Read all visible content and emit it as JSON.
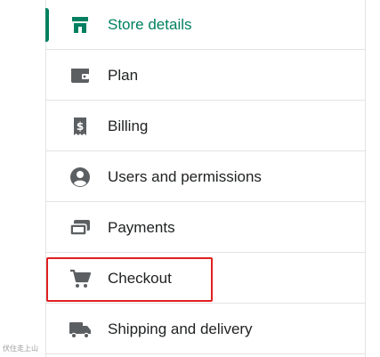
{
  "settings_nav": {
    "items": [
      {
        "label": "Store details",
        "icon": "store-icon",
        "active": true
      },
      {
        "label": "Plan",
        "icon": "wallet-icon",
        "active": false
      },
      {
        "label": "Billing",
        "icon": "dollar-receipt-icon",
        "active": false
      },
      {
        "label": "Users and permissions",
        "icon": "user-circle-icon",
        "active": false
      },
      {
        "label": "Payments",
        "icon": "cards-icon",
        "active": false
      },
      {
        "label": "Checkout",
        "icon": "cart-icon",
        "active": false
      },
      {
        "label": "Shipping and delivery",
        "icon": "truck-icon",
        "active": false
      }
    ]
  },
  "highlight": {
    "target": "Checkout",
    "color": "#e02020"
  },
  "watermark": {
    "text": "伏住走上山"
  },
  "colors": {
    "accent": "#008060",
    "text": "#202223",
    "icon": "#5c5f62",
    "divider": "#e3e3e3"
  }
}
